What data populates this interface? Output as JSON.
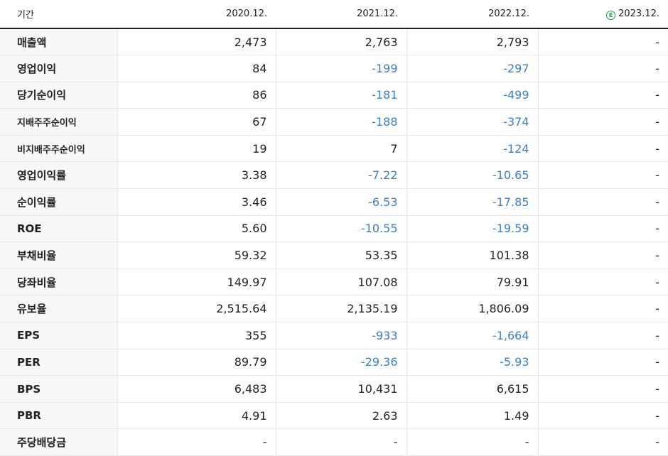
{
  "header": {
    "label": "기간",
    "periods": [
      "2020.12.",
      "2021.12.",
      "2022.12.",
      "2023.12."
    ],
    "estimate_badge": "E"
  },
  "colors": {
    "negative": "#3a7fc8",
    "estimate_badge": "#13a04a"
  },
  "rows": [
    {
      "label": "매출액",
      "values": [
        "2,473",
        "2,763",
        "2,793",
        "-"
      ]
    },
    {
      "label": "영업이익",
      "values": [
        "84",
        "-199",
        "-297",
        "-"
      ]
    },
    {
      "label": "당기순이익",
      "values": [
        "86",
        "-181",
        "-499",
        "-"
      ]
    },
    {
      "label": "지배주주순이익",
      "values": [
        "67",
        "-188",
        "-374",
        "-"
      ]
    },
    {
      "label": "비지배주주순이익",
      "values": [
        "19",
        "7",
        "-124",
        "-"
      ]
    },
    {
      "label": "영업이익률",
      "values": [
        "3.38",
        "-7.22",
        "-10.65",
        "-"
      ]
    },
    {
      "label": "순이익률",
      "values": [
        "3.46",
        "-6.53",
        "-17.85",
        "-"
      ]
    },
    {
      "label": "ROE",
      "values": [
        "5.60",
        "-10.55",
        "-19.59",
        "-"
      ]
    },
    {
      "label": "부채비율",
      "values": [
        "59.32",
        "53.35",
        "101.38",
        "-"
      ]
    },
    {
      "label": "당좌비율",
      "values": [
        "149.97",
        "107.08",
        "79.91",
        "-"
      ]
    },
    {
      "label": "유보율",
      "values": [
        "2,515.64",
        "2,135.19",
        "1,806.09",
        "-"
      ]
    },
    {
      "label": "EPS",
      "values": [
        "355",
        "-933",
        "-1,664",
        "-"
      ]
    },
    {
      "label": "PER",
      "values": [
        "89.79",
        "-29.36",
        "-5.93",
        "-"
      ]
    },
    {
      "label": "BPS",
      "values": [
        "6,483",
        "10,431",
        "6,615",
        "-"
      ]
    },
    {
      "label": "PBR",
      "values": [
        "4.91",
        "2.63",
        "1.49",
        "-"
      ]
    },
    {
      "label": "주당배당금",
      "values": [
        "-",
        "-",
        "-",
        "-"
      ]
    }
  ]
}
